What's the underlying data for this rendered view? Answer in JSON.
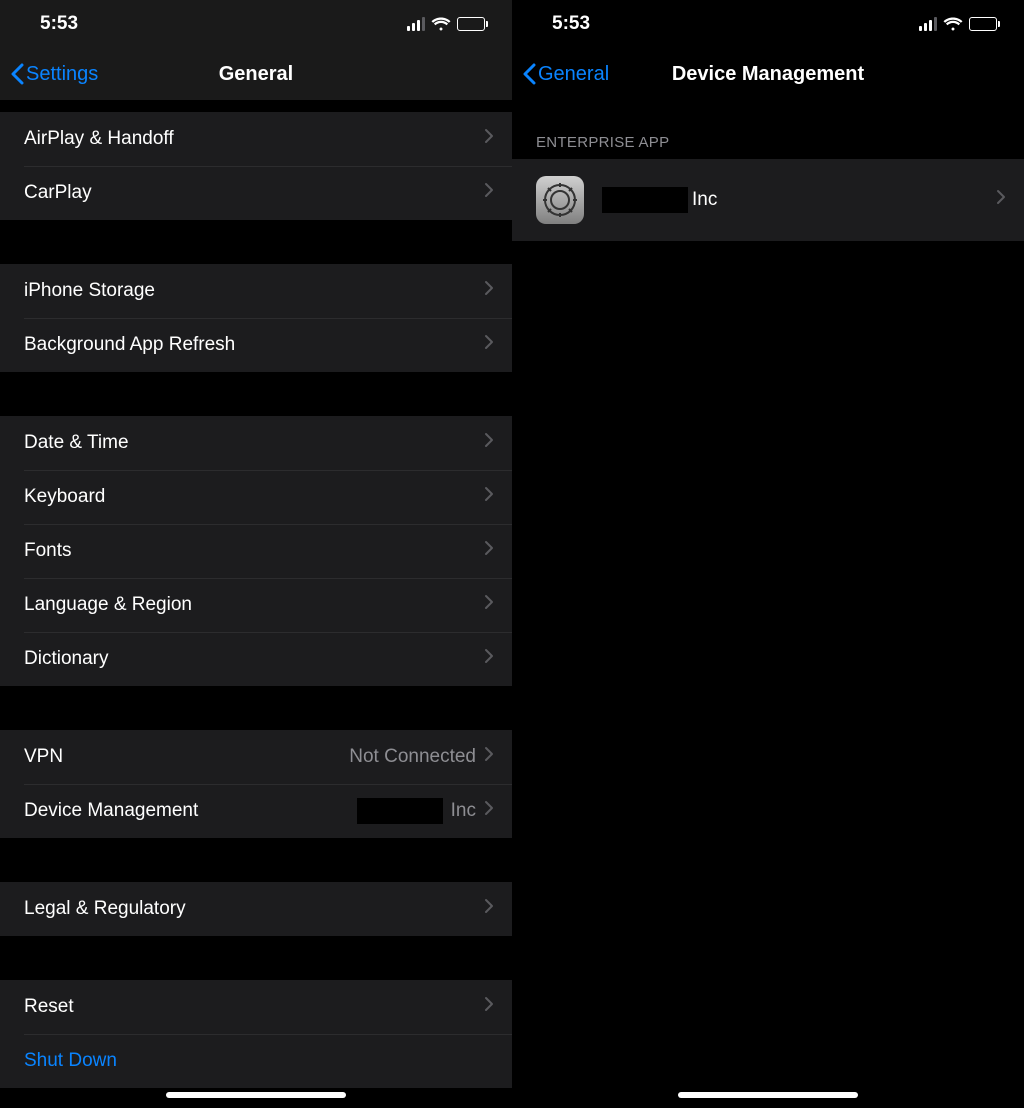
{
  "left": {
    "status": {
      "time": "5:53"
    },
    "nav": {
      "back": "Settings",
      "title": "General"
    },
    "sections": [
      {
        "items": [
          {
            "id": "airplay",
            "label": "AirPlay & Handoff"
          },
          {
            "id": "carplay",
            "label": "CarPlay"
          }
        ]
      },
      {
        "items": [
          {
            "id": "storage",
            "label": "iPhone Storage"
          },
          {
            "id": "bgrefresh",
            "label": "Background App Refresh"
          }
        ]
      },
      {
        "items": [
          {
            "id": "datetime",
            "label": "Date & Time"
          },
          {
            "id": "keyboard",
            "label": "Keyboard"
          },
          {
            "id": "fonts",
            "label": "Fonts"
          },
          {
            "id": "langregion",
            "label": "Language & Region"
          },
          {
            "id": "dictionary",
            "label": "Dictionary"
          }
        ]
      },
      {
        "items": [
          {
            "id": "vpn",
            "label": "VPN",
            "value": "Not Connected"
          },
          {
            "id": "devicemgmt",
            "label": "Device Management",
            "value_suffix": "Inc",
            "redacted": true
          }
        ]
      },
      {
        "items": [
          {
            "id": "legal",
            "label": "Legal & Regulatory"
          }
        ]
      },
      {
        "items": [
          {
            "id": "reset",
            "label": "Reset"
          },
          {
            "id": "shutdown",
            "label": "Shut Down",
            "no_chevron": true,
            "style": "shutdown"
          }
        ]
      }
    ]
  },
  "right": {
    "status": {
      "time": "5:53"
    },
    "nav": {
      "back": "General",
      "title": "Device Management"
    },
    "section_header": "ENTERPRISE APP",
    "profile": {
      "name_suffix": "Inc",
      "redacted": true
    }
  }
}
